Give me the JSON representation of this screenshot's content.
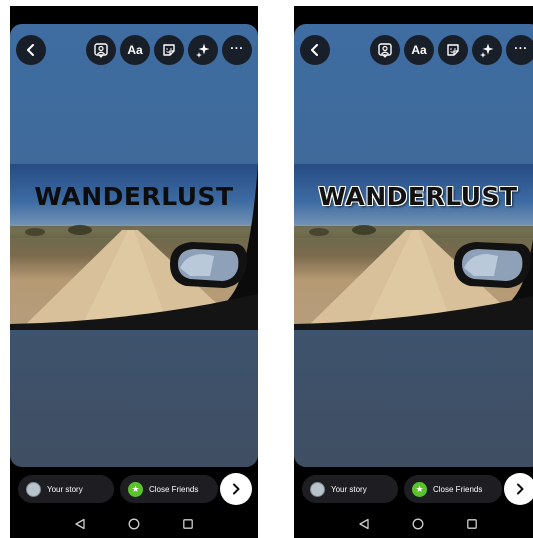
{
  "panels": [
    {
      "id": "left",
      "overlay_text": "WANDERLUST",
      "overlay_style": "plain",
      "share": {
        "your_story": "Your story",
        "close_friends": "Close Friends"
      }
    },
    {
      "id": "right",
      "overlay_text": "WANDERLUST",
      "overlay_style": "outlined",
      "share": {
        "your_story": "Your story",
        "close_friends": "Close Friends"
      }
    }
  ],
  "toolbar": {
    "text_tool_label": "Aa",
    "more_label": "···"
  },
  "icons": {
    "back": "chevron-left-icon",
    "mention": "person-tag-icon",
    "sticker": "sticker-icon",
    "effects": "sparkles-icon",
    "more": "more-dots-icon",
    "close_friends": "star-icon",
    "next": "chevron-right-icon",
    "nav_back": "triangle-back-icon",
    "nav_home": "circle-home-icon",
    "nav_recent": "square-recent-icon"
  },
  "colors": {
    "story_top": "#3f6da2",
    "story_bottom": "#3f4e62",
    "close_friends_green": "#5cc22b",
    "pill_bg": "#1e1e22"
  }
}
